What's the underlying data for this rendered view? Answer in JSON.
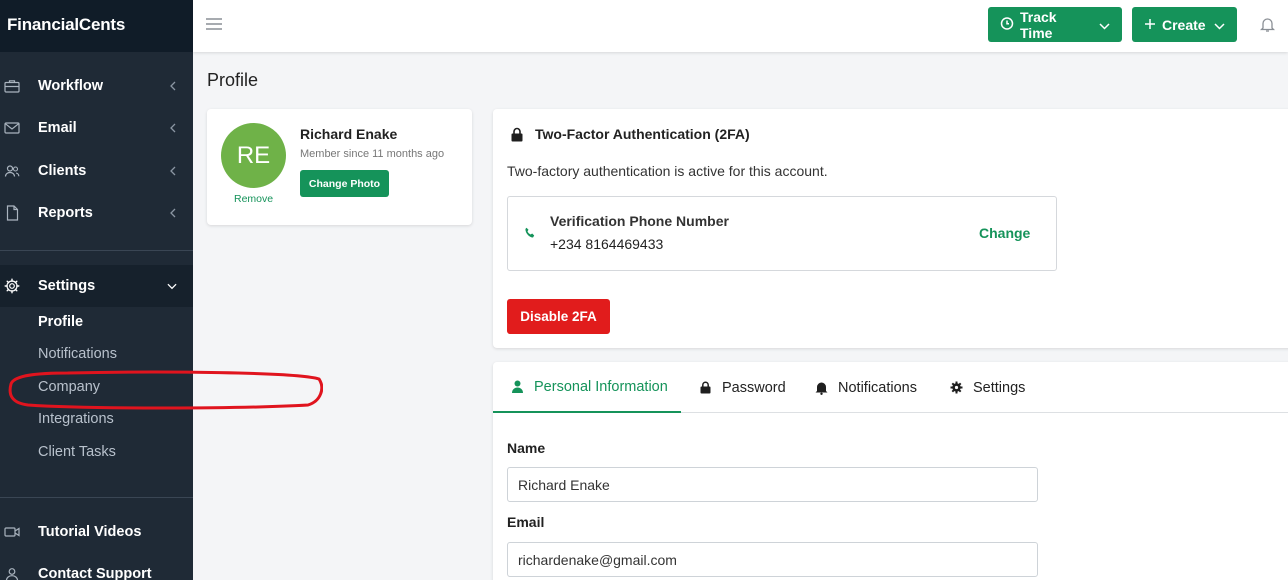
{
  "brand": "FinancialCents",
  "sidebar": {
    "items": [
      {
        "label": "Workflow",
        "icon": "briefcase-icon"
      },
      {
        "label": "Email",
        "icon": "envelope-icon"
      },
      {
        "label": "Clients",
        "icon": "users-icon"
      },
      {
        "label": "Reports",
        "icon": "document-icon"
      }
    ],
    "settings": {
      "label": "Settings",
      "icon": "gear-icon",
      "sub_items": [
        "Profile",
        "Notifications",
        "Company",
        "Integrations",
        "Client Tasks"
      ],
      "active": "Profile"
    },
    "bottom_items": [
      {
        "label": "Tutorial Videos",
        "icon": "video-icon"
      },
      {
        "label": "Contact Support",
        "icon": "person-icon"
      }
    ]
  },
  "topbar": {
    "track_time_label": "Track Time",
    "create_label": "Create"
  },
  "page": {
    "title": "Profile"
  },
  "profile_card": {
    "initials": "RE",
    "name": "Richard Enake",
    "member_since": "Member since 11 months ago",
    "change_photo_label": "Change Photo",
    "remove_label": "Remove"
  },
  "two_factor": {
    "title": "Two-Factor Authentication (2FA)",
    "description": "Two-factory authentication is active for this account.",
    "phone_label": "Verification Phone Number",
    "phone_number": "+234 8164469433",
    "change_label": "Change",
    "disable_label": "Disable 2FA"
  },
  "tabs": [
    {
      "label": "Personal Information",
      "icon": "user-icon",
      "active": true
    },
    {
      "label": "Password",
      "icon": "lock-icon",
      "active": false
    },
    {
      "label": "Notifications",
      "icon": "bell-icon",
      "active": false
    },
    {
      "label": "Settings",
      "icon": "gear-icon",
      "active": false
    }
  ],
  "form": {
    "name_label": "Name",
    "name_value": "Richard Enake",
    "email_label": "Email",
    "email_value": "richardenake@gmail.com"
  },
  "colors": {
    "accent": "#15935a",
    "danger": "#e11c1c",
    "sidebar": "#1f2a36",
    "annotation": "#e0141e"
  }
}
